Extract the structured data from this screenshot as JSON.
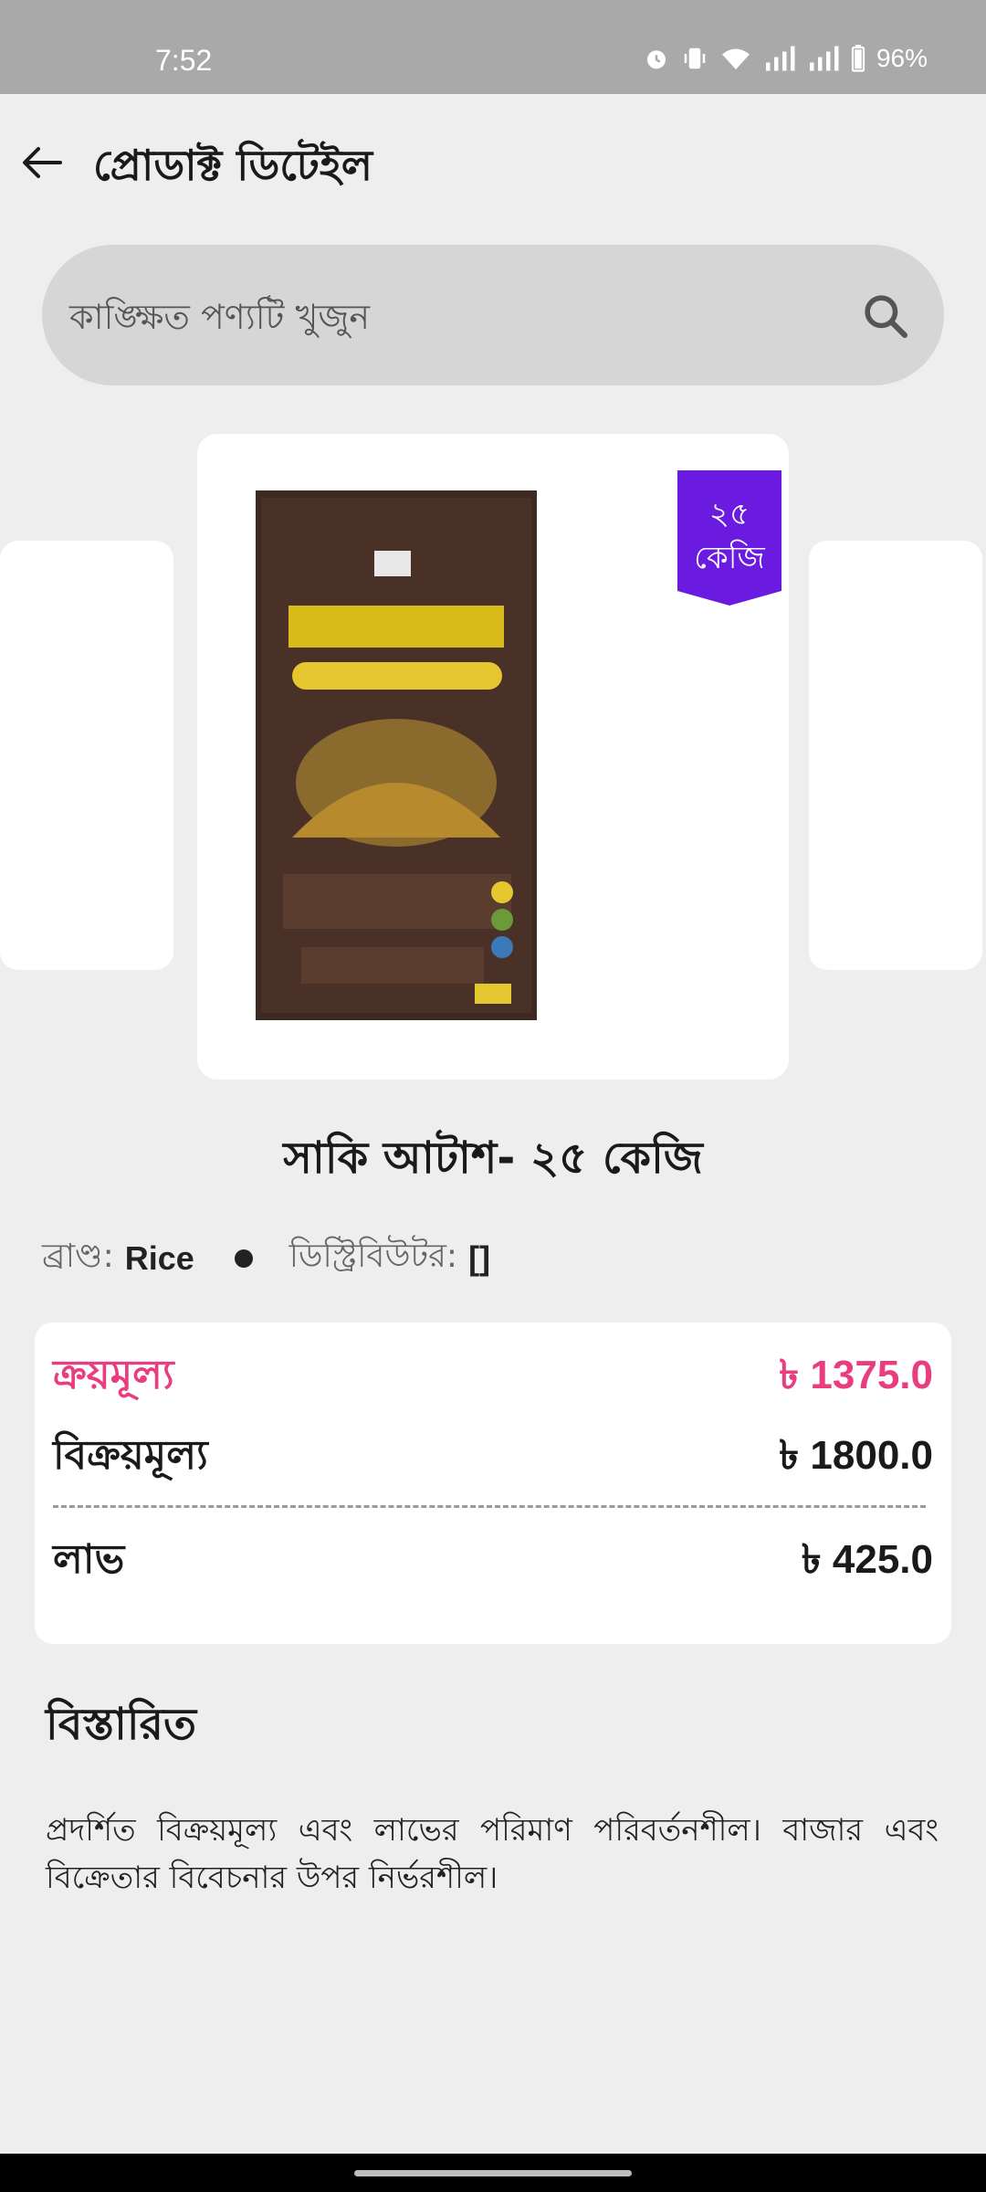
{
  "status_bar": {
    "time": "7:52",
    "battery": "96%"
  },
  "header": {
    "title": "প্রোডাক্ট ডিটেইল"
  },
  "search": {
    "placeholder": "কাঙ্ক্ষিত পণ্যটি খুজুন"
  },
  "product": {
    "weight_badge_line1": "২৫",
    "weight_badge_line2": "কেজি",
    "name": "সাকি আটাশ- ২৫ কেজি",
    "brand_label": "ব্রাণ্ড:",
    "brand_value": "Rice",
    "distributor_label": "ডিস্ট্রিবিউটর:",
    "distributor_value": "[]"
  },
  "pricing": {
    "purchase_label": "ক্রয়মূল্য",
    "purchase_value": "৳ 1375.0",
    "sale_label": "বিক্রয়মূল্য",
    "sale_value": "৳ 1800.0",
    "profit_label": "লাভ",
    "profit_value": "৳ 425.0"
  },
  "details": {
    "title": "বিস্তারিত",
    "text": "প্রদর্শিত বিক্রয়মূল্য এবং লাভের পরিমাণ পরিবর্তনশীল। বাজার এবং বিক্রেতার বিবেচনার উপর নির্ভরশীল।"
  },
  "colors": {
    "accent_pink": "#e83e7f",
    "badge_purple": "#6a1bdf",
    "status_bar": "#a9a9a9"
  }
}
